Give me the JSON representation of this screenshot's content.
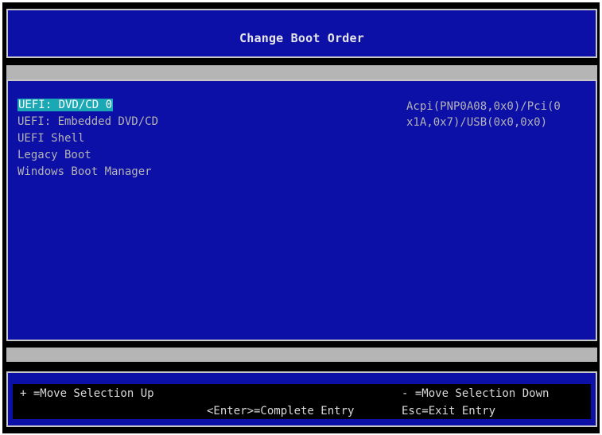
{
  "header": {
    "title": "Change Boot Order"
  },
  "boot_list": {
    "items": [
      {
        "label": "UEFI: DVD/CD 0",
        "selected": true
      },
      {
        "label": "UEFI: Embedded DVD/CD",
        "selected": false
      },
      {
        "label": "UEFI Shell",
        "selected": false
      },
      {
        "label": "Legacy Boot",
        "selected": false
      },
      {
        "label": "Windows Boot Manager",
        "selected": false
      }
    ]
  },
  "help": {
    "line1": "Acpi(PNP0A08,0x0)/Pci(0",
    "line2": "x1A,0x7)/USB(0x0,0x0)"
  },
  "footer": {
    "move_up": "+ =Move Selection Up",
    "move_down": "- =Move Selection Down",
    "complete_entry": "<Enter>=Complete Entry",
    "exit_entry": "Esc=Exit Entry"
  },
  "colors": {
    "background_blue": "#0d10a6",
    "highlight": "#1aa8b5",
    "separator_gray": "#b5b5b5"
  }
}
